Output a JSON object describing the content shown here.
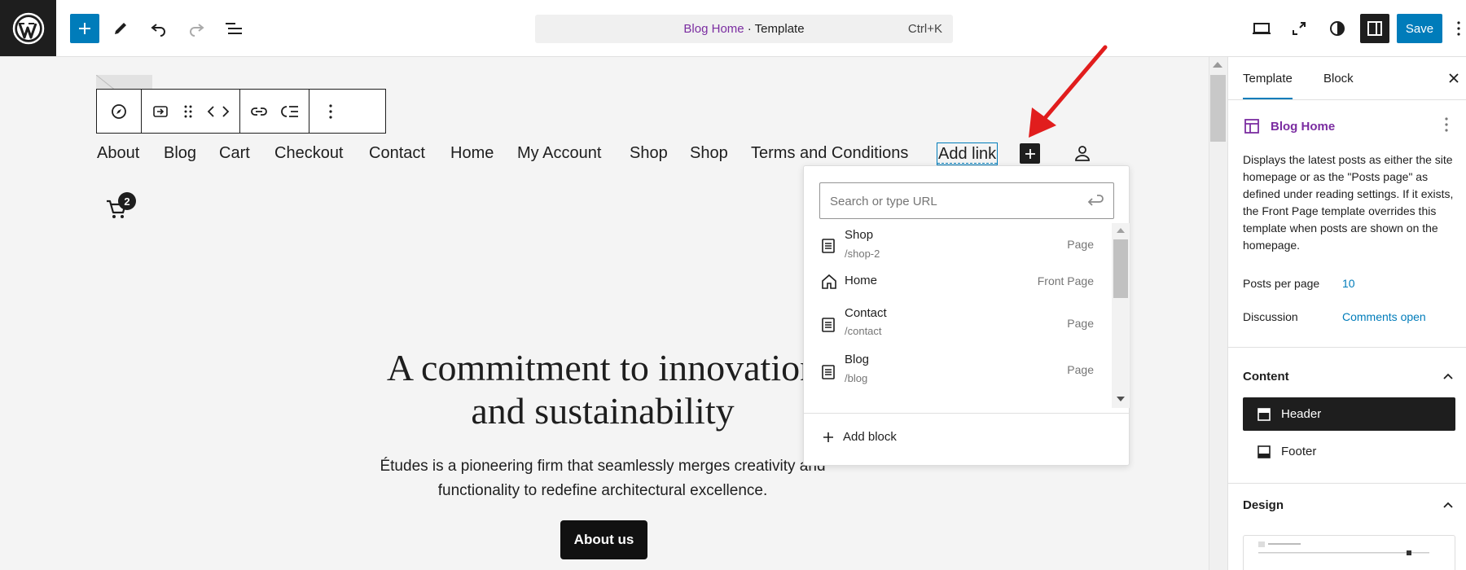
{
  "topbar": {
    "template_name": "Blog Home",
    "template_suffix": " · Template",
    "shortcut": "Ctrl+K",
    "save_label": "Save"
  },
  "block_toolbar": {
    "icons": [
      "navigation-icon",
      "submenu-icon",
      "drag-handle-icon",
      "move-arrows-icon",
      "link-icon",
      "list-view-icon",
      "more-options-icon"
    ]
  },
  "nav": {
    "items": [
      "About",
      "Blog",
      "Cart",
      "Checkout",
      "Contact",
      "Home",
      "My Account",
      "Shop",
      "Shop",
      "Terms and Conditions"
    ],
    "add_link": "Add link"
  },
  "cart": {
    "count": "2"
  },
  "hero": {
    "title_line1": "A commitment to innovation",
    "title_line2": "and sustainability",
    "desc_line1": "Études is a pioneering firm that seamlessly merges creativity and",
    "desc_line2": "functionality to redefine architectural excellence.",
    "button": "About us"
  },
  "link_popover": {
    "search_placeholder": "Search or type URL",
    "suggestions": [
      {
        "title": "Shop",
        "path": "/shop-2",
        "type": "Page",
        "icon": "page-icon"
      },
      {
        "title": "Home",
        "path": "",
        "type": "Front Page",
        "icon": "home-icon"
      },
      {
        "title": "Contact",
        "path": "/contact",
        "type": "Page",
        "icon": "page-icon"
      },
      {
        "title": "Blog",
        "path": "/blog",
        "type": "Page",
        "icon": "page-icon"
      }
    ],
    "add_block": "Add block"
  },
  "sidebar": {
    "tabs": [
      "Template",
      "Block"
    ],
    "template_title": "Blog Home",
    "description": "Displays the latest posts as either the site homepage or as the \"Posts page\" as defined under reading settings. If it exists, the Front Page template overrides this template when posts are shown on the homepage.",
    "posts_per_page_label": "Posts per page",
    "posts_per_page_value": "10",
    "discussion_label": "Discussion",
    "discussion_value": "Comments open",
    "content_title": "Content",
    "parts": [
      "Header",
      "Footer"
    ],
    "design_title": "Design"
  },
  "colors": {
    "accent": "#007cba",
    "template_purple": "#7b2da1",
    "annotation_red": "#e11d1d",
    "dark": "#1e1e1e"
  }
}
